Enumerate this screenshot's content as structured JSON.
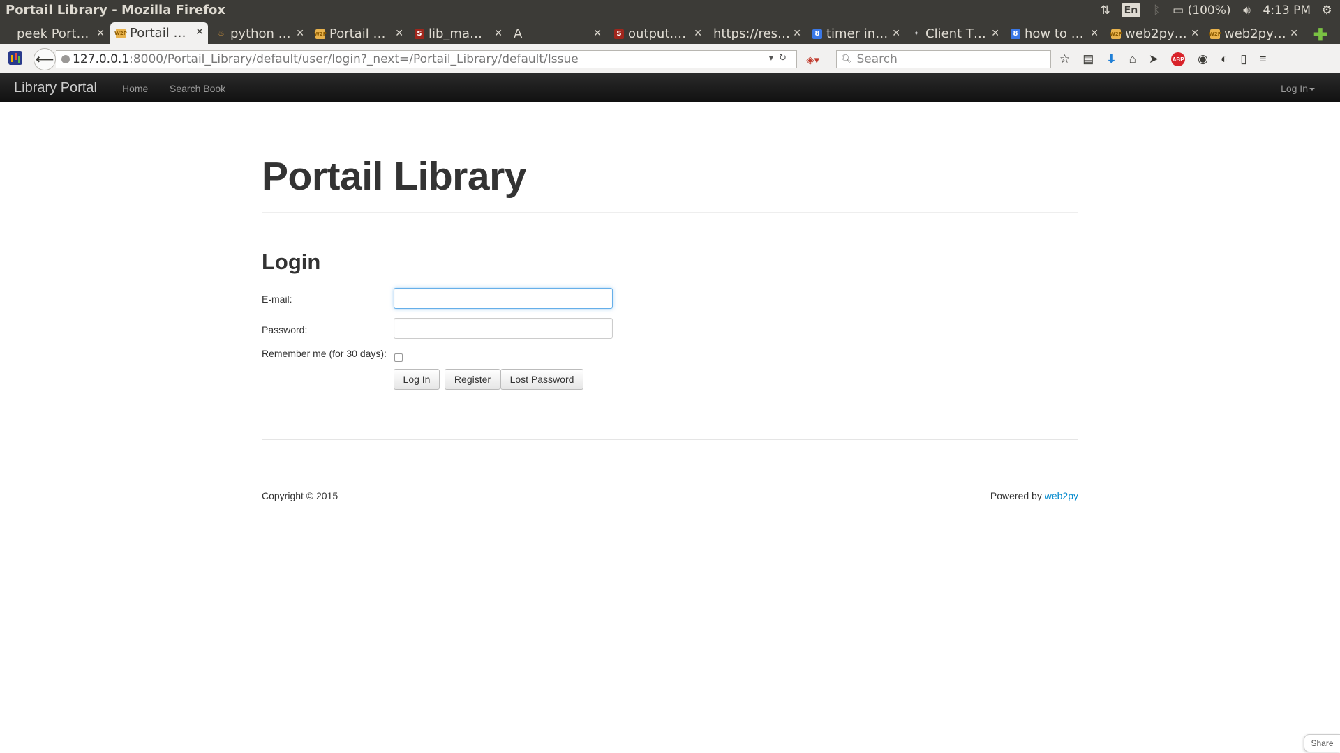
{
  "os": {
    "window_title": "Portail Library - Mozilla Firefox",
    "language": "En",
    "battery": "(100%)",
    "clock": "4:13 PM"
  },
  "tabs": [
    {
      "label": "peek Port…",
      "favicon": "none"
    },
    {
      "label": "Portail …",
      "favicon": "web2py-icon"
    },
    {
      "label": "python …",
      "favicon": "python-icon"
    },
    {
      "label": "Portail …",
      "favicon": "web2py-icon"
    },
    {
      "label": "lib_ma…",
      "favicon": "S"
    },
    {
      "label": "A",
      "favicon": "none"
    },
    {
      "label": "output.…",
      "favicon": "S"
    },
    {
      "label": "https://res…",
      "favicon": "none"
    },
    {
      "label": "timer in…",
      "favicon": "8"
    },
    {
      "label": "Client T…",
      "favicon": "client-icon"
    },
    {
      "label": "how to …",
      "favicon": "8"
    },
    {
      "label": "web2py…",
      "favicon": "web2py-icon"
    },
    {
      "label": "web2py…",
      "favicon": "web2py-icon"
    }
  ],
  "toolbar": {
    "url_host": "127.0.0.1",
    "url_path": ":8000/Portail_Library/default/user/login?_next=/Portail_Library/default/Issue",
    "search_placeholder": "Search",
    "abp_label": "ABP"
  },
  "navbar": {
    "brand": "Library Portal",
    "home": "Home",
    "search_book": "Search Book",
    "login": "Log In"
  },
  "page": {
    "title": "Portail Library",
    "form_title": "Login",
    "email_label": "E-mail:",
    "email_value": "",
    "password_label": "Password:",
    "password_value": "",
    "remember_label": "Remember me (for 30 days):",
    "remember_checked": false,
    "login_button": "Log In",
    "register_button": "Register",
    "lost_password_button": "Lost Password"
  },
  "footer": {
    "copyright": "Copyright © 2015",
    "powered_by": "Powered by",
    "powered_link": "web2py"
  },
  "share_label": "Share",
  "colors": {
    "os_bar": "#3c3b37",
    "navbar": "#111111",
    "link": "#0088cc",
    "focus": "#66afe9"
  }
}
